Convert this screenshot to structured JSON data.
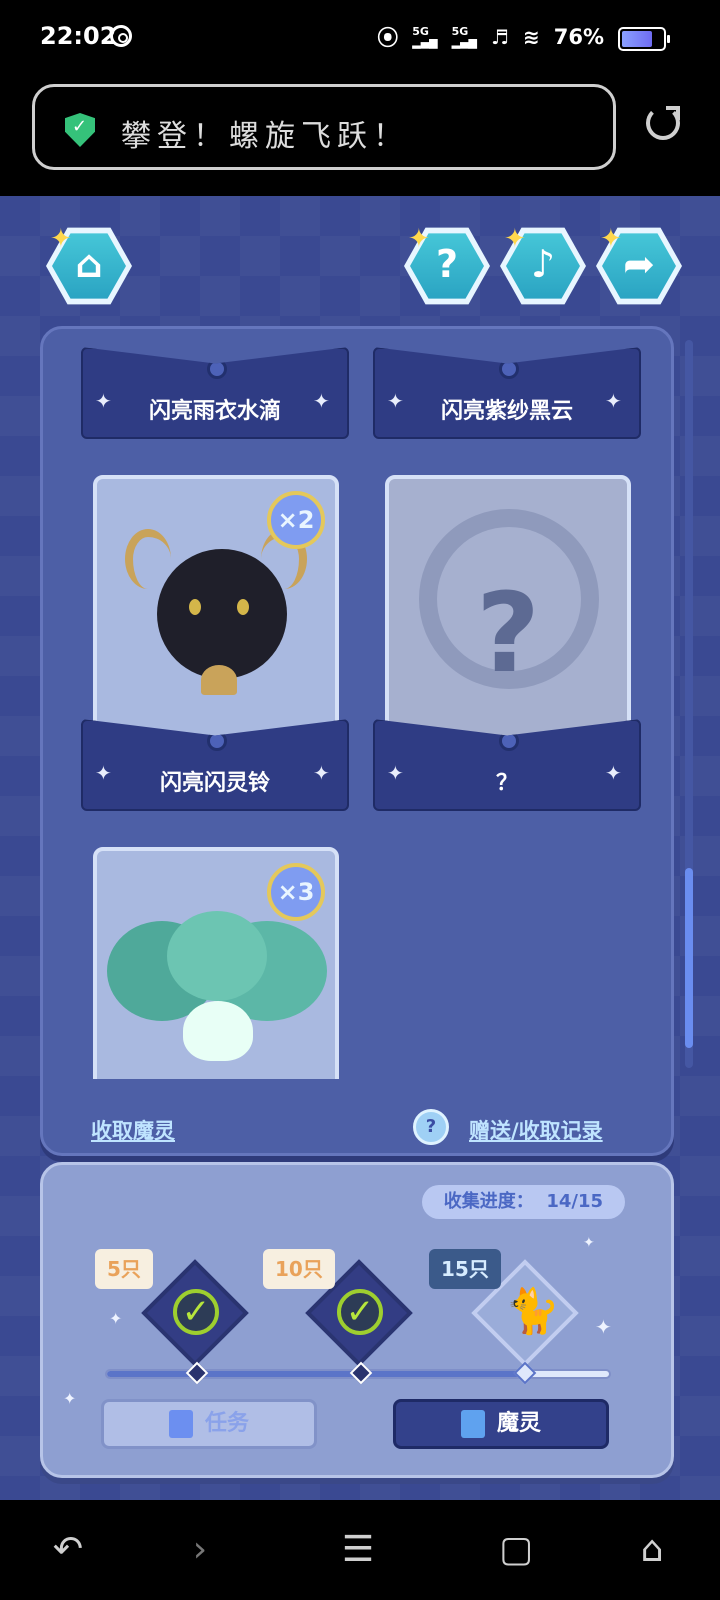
{
  "status": {
    "time": "22:02",
    "sig1": "5G",
    "sig2": "5G",
    "battery": "76%"
  },
  "browser": {
    "title": "攀登！螺旋飞跃！"
  },
  "cards": [
    {
      "name": "闪亮雨衣水滴"
    },
    {
      "name": "闪亮紫纱黑云"
    },
    {
      "name": "闪亮闪灵铃",
      "count": "×2"
    },
    {
      "name": "？"
    },
    {
      "name": "",
      "count": "×3"
    }
  ],
  "panel": {
    "collect_link": "收取魔灵",
    "record_link": "赠送/收取记录"
  },
  "progress": {
    "label": "收集进度：",
    "value": "14/15",
    "value_fraction": 0.83,
    "milestones": [
      {
        "tag": "5只"
      },
      {
        "tag": "10只"
      },
      {
        "tag": "15只"
      }
    ],
    "buttons": {
      "task": "任务",
      "spirit": "魔灵"
    }
  },
  "colors": {
    "accent": "#3a4992",
    "check": "#9ecf2f"
  }
}
